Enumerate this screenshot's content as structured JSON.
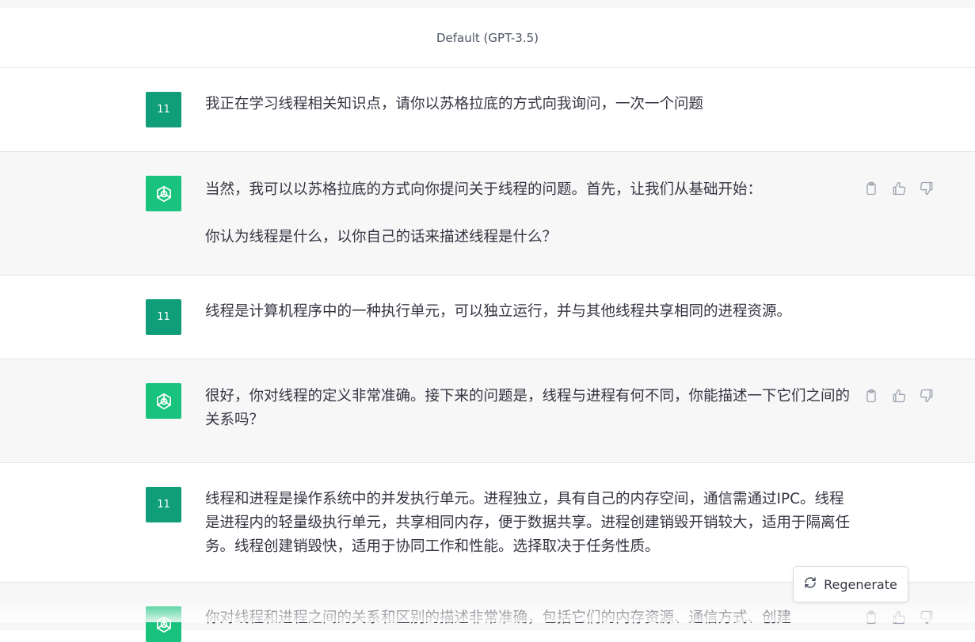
{
  "header": {
    "model_title": "Default (GPT-3.5)"
  },
  "user_avatar_label": "11",
  "conversation": [
    {
      "role": "user",
      "paragraphs": [
        "我正在学习线程相关知识点，请你以苏格拉底的方式向我询问，一次一个问题"
      ]
    },
    {
      "role": "assistant",
      "paragraphs": [
        "当然，我可以以苏格拉底的方式向你提问关于线程的问题。首先，让我们从基础开始：",
        "你认为线程是什么，以你自己的话来描述线程是什么？"
      ]
    },
    {
      "role": "user",
      "paragraphs": [
        "线程是计算机程序中的一种执行单元，可以独立运行，并与其他线程共享相同的进程资源。"
      ]
    },
    {
      "role": "assistant",
      "paragraphs": [
        "很好，你对线程的定义非常准确。接下来的问题是，线程与进程有何不同，你能描述一下它们之间的关系吗？"
      ]
    },
    {
      "role": "user",
      "paragraphs": [
        "线程和进程是操作系统中的并发执行单元。进程独立，具有自己的内存空间，通信需通过IPC。线程是进程内的轻量级执行单元，共享相同内存，便于数据共享。进程创建销毁开销较大，适用于隔离任务。线程创建销毁快，适用于协同工作和性能。选择取决于任务性质。"
      ]
    },
    {
      "role": "assistant",
      "paragraphs": [
        "你对线程和进程之间的关系和区别的描述非常准确，包括它们的内存资源、通信方式、创建"
      ]
    }
  ],
  "icons": {
    "copy": "clipboard-icon",
    "like": "thumbs-up-icon",
    "dislike": "thumbs-down-icon",
    "bot_avatar": "openai-logo-icon",
    "regenerate": "refresh-icon"
  },
  "regenerate_label": "Regenerate",
  "colors": {
    "user_avatar": "#0f9d7a",
    "bot_avatar": "#19c37d",
    "assistant_bg": "#f7f7f8"
  }
}
